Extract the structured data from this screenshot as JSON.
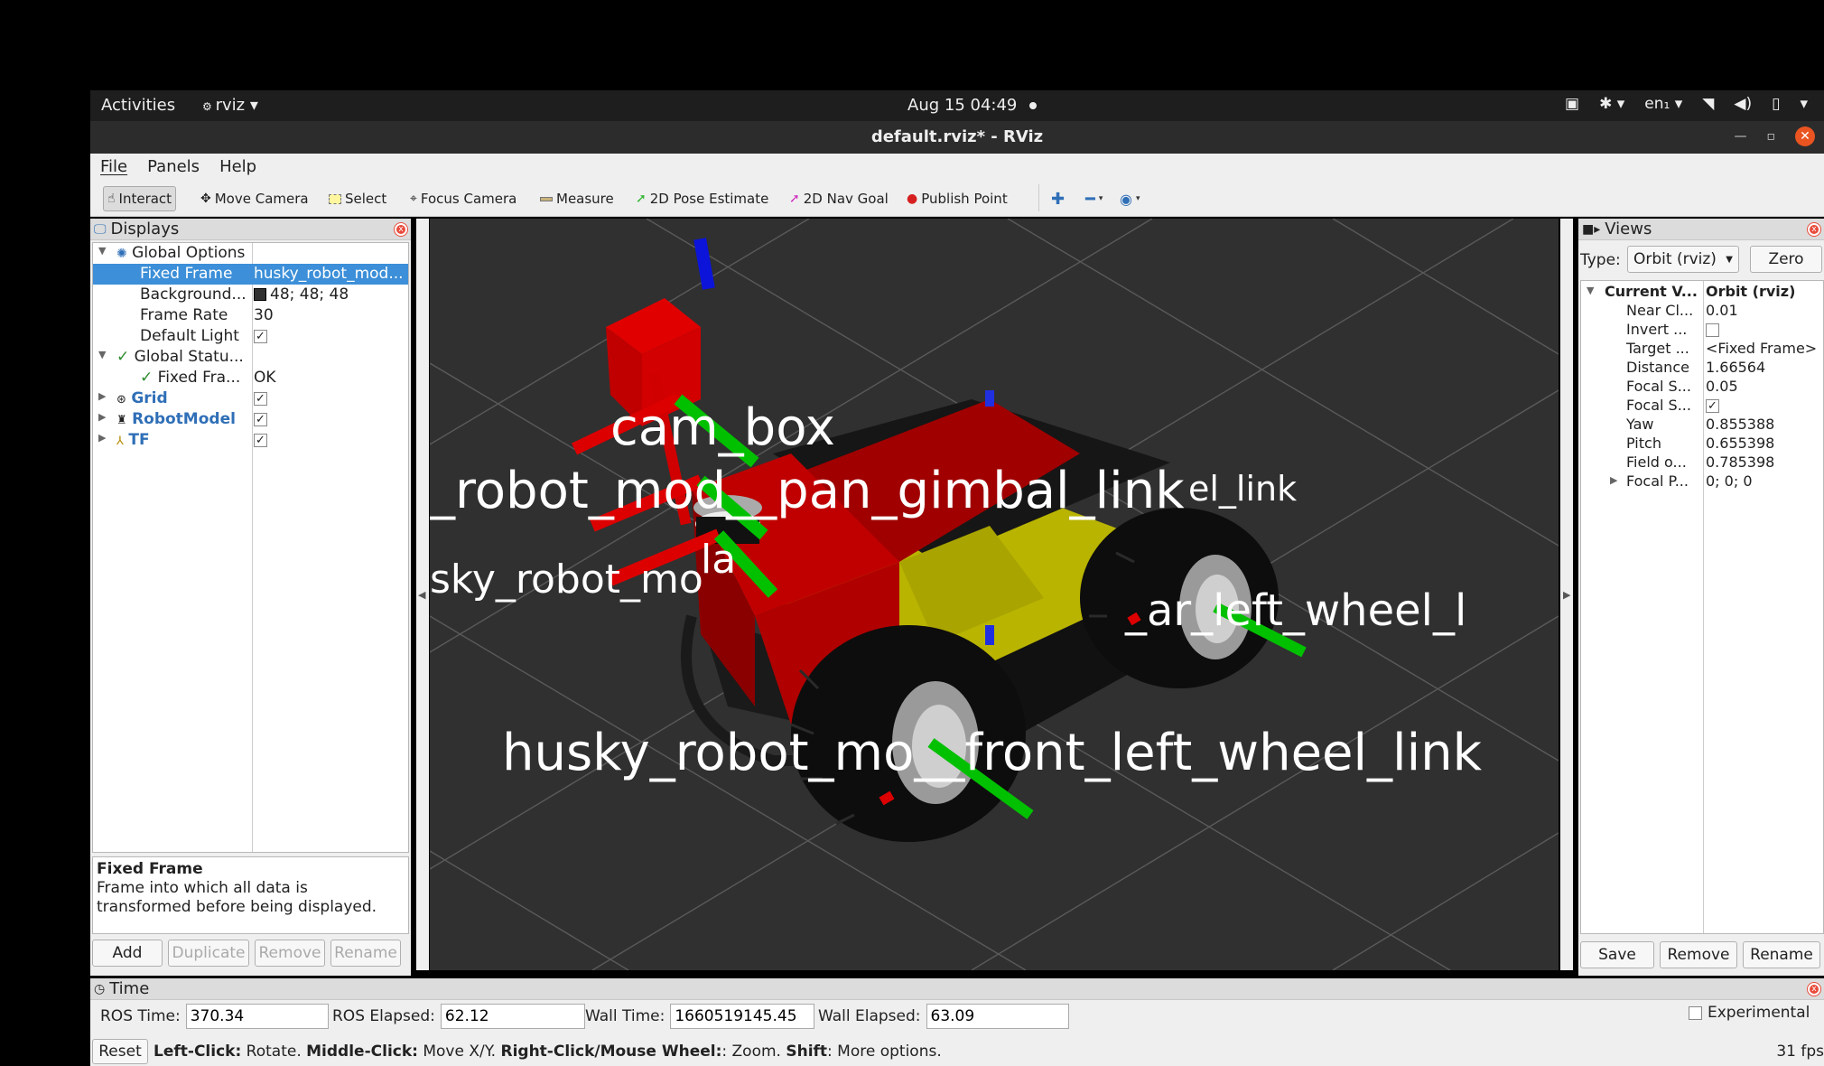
{
  "topbar": {
    "activities": "Activities",
    "app_name": "rviz",
    "clock": "Aug 15  04:49",
    "lang": "en₁",
    "icons": [
      "camera-icon",
      "accessibility-icon",
      "network-icon",
      "volume-icon",
      "battery-icon",
      "power-menu-icon"
    ]
  },
  "window": {
    "title": "default.rviz* - RViz"
  },
  "menu": {
    "file": "File",
    "panels": "Panels",
    "help": "Help"
  },
  "toolbar": {
    "interact": "Interact",
    "move_camera": "Move Camera",
    "select": "Select",
    "focus_camera": "Focus Camera",
    "measure": "Measure",
    "pose_estimate": "2D Pose Estimate",
    "nav_goal": "2D Nav Goal",
    "publish_point": "Publish Point"
  },
  "displays": {
    "title": "Displays",
    "rows": {
      "global_options": "Global Options",
      "fixed_frame": "Fixed Frame",
      "fixed_frame_val": "husky_robot_mod...",
      "background": "Background...",
      "background_val": "48; 48; 48",
      "frame_rate": "Frame Rate",
      "frame_rate_val": "30",
      "default_light": "Default Light",
      "global_status": "Global Statu...",
      "fixed_frame_status": "Fixed Fra...",
      "fixed_frame_status_val": "OK",
      "grid": "Grid",
      "robot_model": "RobotModel",
      "tf": "TF"
    },
    "desc_title": "Fixed Frame",
    "desc_text": "Frame into which all data is transformed before being displayed.",
    "buttons": {
      "add": "Add",
      "duplicate": "Duplicate",
      "remove": "Remove",
      "rename": "Rename"
    }
  },
  "viewport": {
    "labels": {
      "cam_box": "cam_box",
      "pan_gimbal": "_robot_mod__pan_gimbal_link",
      "el_link": "el_link",
      "la": "la",
      "husky_mo": "sky_robot_mo",
      "rear_left": "_ar_left_wheel_l",
      "front_left": "husky_robot_mo__front_left_wheel_link"
    },
    "background_color": "#303030"
  },
  "views": {
    "title": "Views",
    "type_label": "Type:",
    "type_value": "Orbit (rviz)",
    "zero": "Zero",
    "rows": {
      "current": "Current V...",
      "current_val": "Orbit (rviz)",
      "near_clip": "Near Cl...",
      "near_clip_val": "0.01",
      "invert": "Invert ...",
      "target": "Target ...",
      "target_val": "<Fixed Frame>",
      "distance": "Distance",
      "distance_val": "1.66564",
      "focal_size": "Focal S...",
      "focal_size_val": "0.05",
      "focal_shape": "Focal S...",
      "yaw": "Yaw",
      "yaw_val": "0.855388",
      "pitch": "Pitch",
      "pitch_val": "0.655398",
      "fov": "Field o...",
      "fov_val": "0.785398",
      "focal_point": "Focal P...",
      "focal_point_val": "0; 0; 0"
    },
    "buttons": {
      "save": "Save",
      "remove": "Remove",
      "rename": "Rename"
    }
  },
  "time": {
    "title": "Time",
    "ros_time_label": "ROS Time:",
    "ros_time": "370.34",
    "ros_elapsed_label": "ROS Elapsed:",
    "ros_elapsed": "62.12",
    "wall_time_label": "Wall Time:",
    "wall_time": "1660519145.45",
    "wall_elapsed_label": "Wall Elapsed:",
    "wall_elapsed": "63.09",
    "experimental": "Experimental"
  },
  "status": {
    "reset": "Reset",
    "h1": "Left-Click:",
    "t1": " Rotate. ",
    "h2": "Middle-Click:",
    "t2": " Move X/Y. ",
    "h3": "Right-Click/Mouse Wheel:",
    "t3": ": Zoom. ",
    "h4": "Shift",
    "t4": ": More options.",
    "fps": "31 fps"
  }
}
